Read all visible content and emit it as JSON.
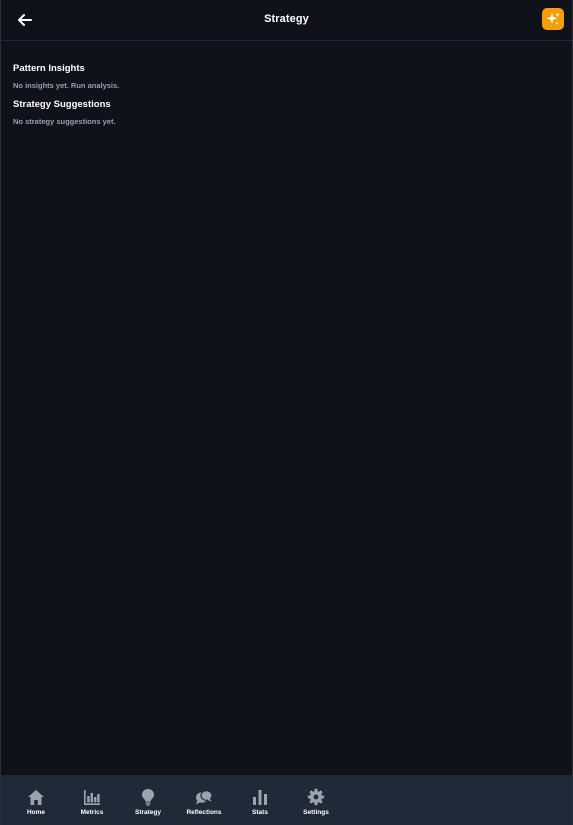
{
  "header": {
    "back_icon": "arrow-left-icon",
    "title": "Strategy",
    "ai_button_icon": "sparkles-icon",
    "ai_button_color": "#f59e0b"
  },
  "sections": [
    {
      "title": "Pattern Insights",
      "empty_text": "No insights yet. Run analysis."
    },
    {
      "title": "Strategy Suggestions",
      "empty_text": "No strategy suggestions yet."
    }
  ],
  "bottom_nav": {
    "items": [
      {
        "label": "Home",
        "icon": "home-icon"
      },
      {
        "label": "Metrics",
        "icon": "bar-chart-icon"
      },
      {
        "label": "Strategy",
        "icon": "lightbulb-icon"
      },
      {
        "label": "Reflections",
        "icon": "chat-bubbles-icon"
      },
      {
        "label": "Stats",
        "icon": "stats-icon"
      },
      {
        "label": "Settings",
        "icon": "gear-icon"
      }
    ]
  },
  "colors": {
    "background": "#0f1219",
    "nav_background": "#1f2937",
    "accent": "#f59e0b",
    "muted_text": "#9aa0ab",
    "icon_gray": "#9ca3af"
  }
}
